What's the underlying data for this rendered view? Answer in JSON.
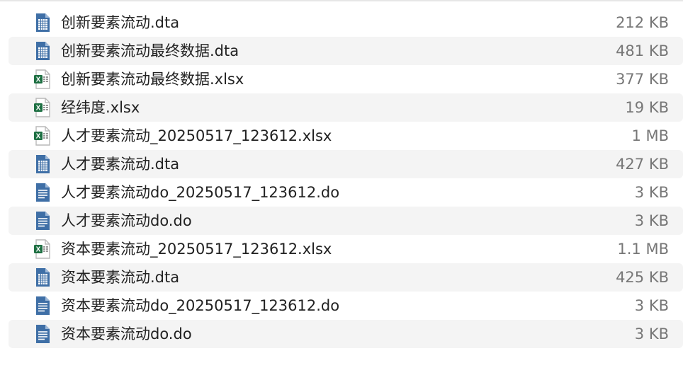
{
  "files": [
    {
      "name": "创新要素流动.dta",
      "size": "212 KB",
      "icon": "dta-file-icon"
    },
    {
      "name": "创新要素流动最终数据.dta",
      "size": "481 KB",
      "icon": "dta-file-icon"
    },
    {
      "name": "创新要素流动最终数据.xlsx",
      "size": "377 KB",
      "icon": "excel-file-icon"
    },
    {
      "name": "经纬度.xlsx",
      "size": "19 KB",
      "icon": "excel-file-icon"
    },
    {
      "name": "人才要素流动_20250517_123612.xlsx",
      "size": "1 MB",
      "icon": "excel-file-icon"
    },
    {
      "name": "人才要素流动.dta",
      "size": "427 KB",
      "icon": "dta-file-icon"
    },
    {
      "name": "人才要素流动do_20250517_123612.do",
      "size": "3 KB",
      "icon": "do-file-icon"
    },
    {
      "name": "人才要素流动do.do",
      "size": "3 KB",
      "icon": "do-file-icon"
    },
    {
      "name": "资本要素流动_20250517_123612.xlsx",
      "size": "1.1 MB",
      "icon": "excel-file-icon"
    },
    {
      "name": "资本要素流动.dta",
      "size": "425 KB",
      "icon": "dta-file-icon"
    },
    {
      "name": "资本要素流动do_20250517_123612.do",
      "size": "3 KB",
      "icon": "do-file-icon"
    },
    {
      "name": "资本要素流动do.do",
      "size": "3 KB",
      "icon": "do-file-icon"
    }
  ],
  "colors": {
    "stata_blue": "#3f6fa6",
    "excel_green": "#1d6f42",
    "row_alt": "#f4f4f4",
    "size_text": "#777777"
  }
}
